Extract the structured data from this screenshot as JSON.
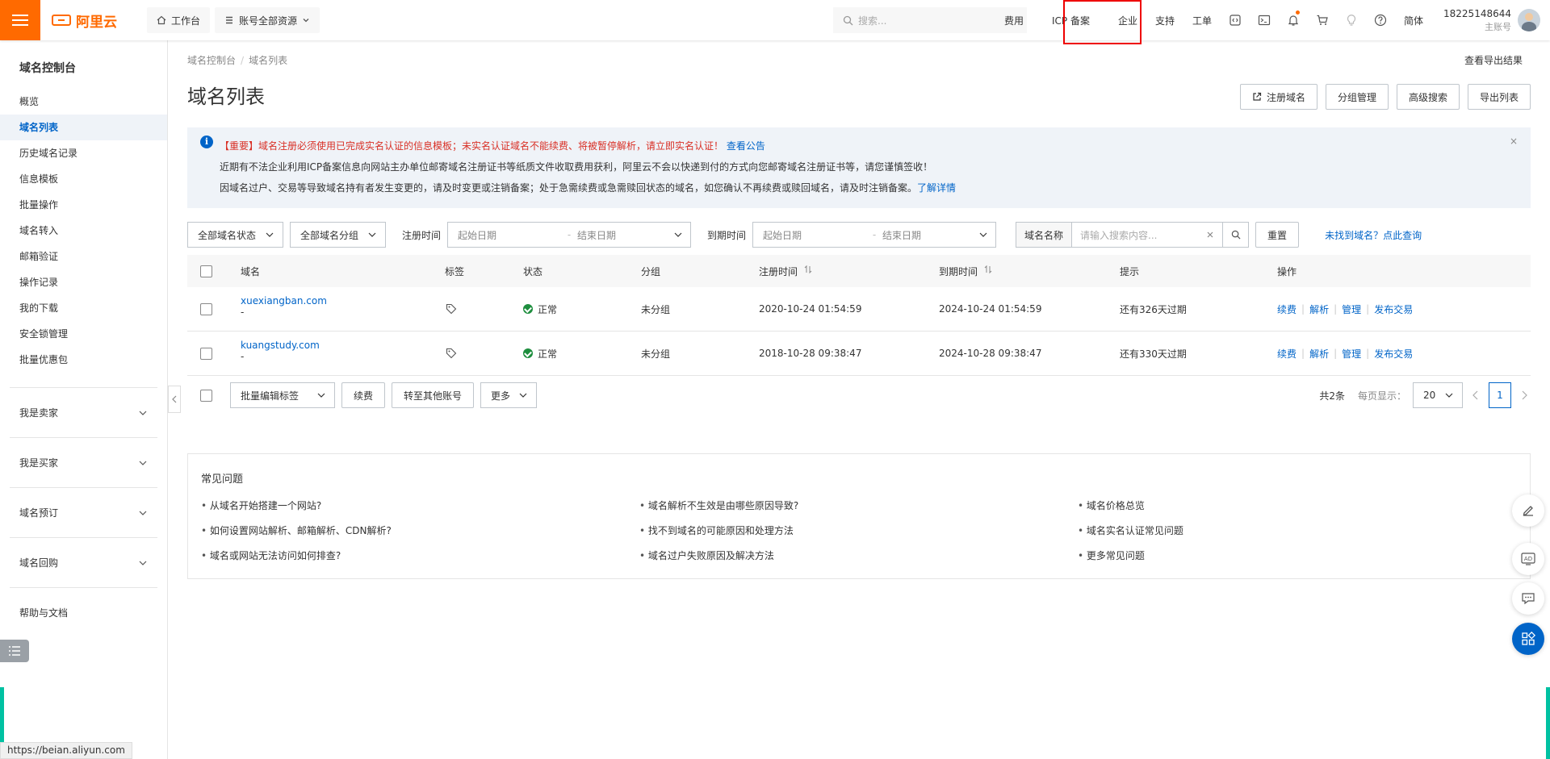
{
  "topbar": {
    "logo_text": "阿里云",
    "workbench": "工作台",
    "resources": "账号全部资源",
    "search_placeholder": "搜索...",
    "nav": [
      "费用",
      "ICP 备案",
      "企业",
      "支持",
      "工单"
    ],
    "lang": "简体",
    "account_number": "18225148644",
    "account_type": "主账号"
  },
  "sidebar": {
    "title": "域名控制台",
    "items": [
      "概览",
      "域名列表",
      "历史域名记录",
      "信息模板",
      "批量操作",
      "域名转入",
      "邮箱验证",
      "操作记录",
      "我的下载",
      "安全锁管理",
      "批量优惠包"
    ],
    "groups": [
      "我是卖家",
      "我是买家",
      "域名预订",
      "域名回购"
    ],
    "help": "帮助与文档"
  },
  "status_url": "https://beian.aliyun.com",
  "main": {
    "breadcrumb": [
      "域名控制台",
      "域名列表"
    ],
    "export_result": "查看导出结果",
    "title": "域名列表",
    "buttons": {
      "register": "注册域名",
      "group_manage": "分组管理",
      "advanced_search": "高级搜索",
      "export_list": "导出列表"
    },
    "notice": {
      "line1_warn": "【重要】域名注册必须使用已完成实名认证的信息模板；未实名认证域名不能续费、将被暂停解析，请立即实名认证！",
      "line1_link": "查看公告",
      "line2": "近期有不法企业利用ICP备案信息向网站主办单位邮寄域名注册证书等纸质文件收取费用获利，阿里云不会以快递到付的方式向您邮寄域名注册证书等，请您谨慎签收！",
      "line3": "因域名过户、交易等导致域名持有者发生变更的，请及时变更或注销备案；处于急需续费或急需赎回状态的域名，如您确认不再续费或赎回域名，请及时注销备案。",
      "line3_link": "了解详情",
      "close": "×"
    },
    "filters": {
      "status": "全部域名状态",
      "group": "全部域名分组",
      "reg_time_label": "注册时间",
      "exp_time_label": "到期时间",
      "start_date": "起始日期",
      "end_date": "结束日期",
      "dash": "-",
      "search_label": "域名名称",
      "search_placeholder": "请输入搜索内容...",
      "reset": "重置",
      "not_found": "未找到域名？点此查询"
    },
    "table": {
      "headers": [
        "域名",
        "标签",
        "状态",
        "分组",
        "注册时间",
        "到期时间",
        "提示",
        "操作"
      ],
      "rows": [
        {
          "domain": "xuexiangban.com",
          "sub": "-",
          "status": "正常",
          "group": "未分组",
          "reg": "2020-10-24 01:54:59",
          "exp": "2024-10-24 01:54:59",
          "tip": "还有326天过期"
        },
        {
          "domain": "kuangstudy.com",
          "sub": "-",
          "status": "正常",
          "group": "未分组",
          "reg": "2018-10-28 09:38:47",
          "exp": "2024-10-28 09:38:47",
          "tip": "还有330天过期"
        }
      ],
      "ops": [
        "续费",
        "解析",
        "管理",
        "发布交易"
      ]
    },
    "bulk": {
      "edit_tags": "批量编辑标签",
      "renew": "续费",
      "transfer": "转至其他账号",
      "more": "更多",
      "total": "共2条",
      "per_page_label": "每页显示：",
      "per_page": "20",
      "page": "1"
    },
    "faq": {
      "title": "常见问题",
      "items": [
        "从域名开始搭建一个网站?",
        "域名解析不生效是由哪些原因导致?",
        "域名价格总览",
        "如何设置网站解析、邮箱解析、CDN解析?",
        "找不到域名的可能原因和处理方法",
        "域名实名认证常见问题",
        "域名或网站无法访问如何排查?",
        "域名过户失败原因及解决方法",
        "更多常见问题"
      ]
    }
  },
  "colors": {
    "brand": "#ff6a00",
    "link": "#0064c8",
    "success": "#1e8e3e",
    "warn": "#d93026",
    "highlight": "#ee0000"
  }
}
